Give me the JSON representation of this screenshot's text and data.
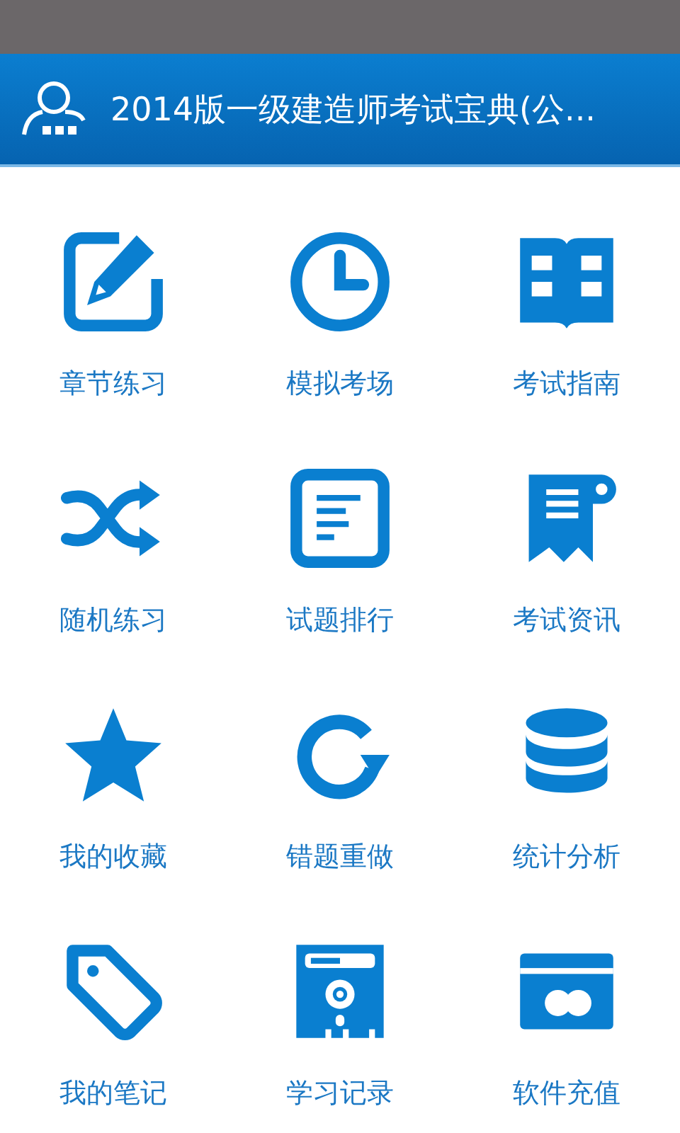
{
  "header": {
    "title": "2014版一级建造师考试宝典(公..."
  },
  "menu": [
    {
      "kind": "edit",
      "label": "章节练习"
    },
    {
      "kind": "clock",
      "label": "模拟考场"
    },
    {
      "kind": "book",
      "label": "考试指南"
    },
    {
      "kind": "shuffle",
      "label": "随机练习"
    },
    {
      "kind": "list",
      "label": "试题排行"
    },
    {
      "kind": "receipt",
      "label": "考试资讯"
    },
    {
      "kind": "star",
      "label": "我的收藏"
    },
    {
      "kind": "redo",
      "label": "错题重做"
    },
    {
      "kind": "database",
      "label": "统计分析"
    },
    {
      "kind": "tag",
      "label": "我的笔记"
    },
    {
      "kind": "disk",
      "label": "学习记录"
    },
    {
      "kind": "card",
      "label": "软件充值"
    }
  ]
}
